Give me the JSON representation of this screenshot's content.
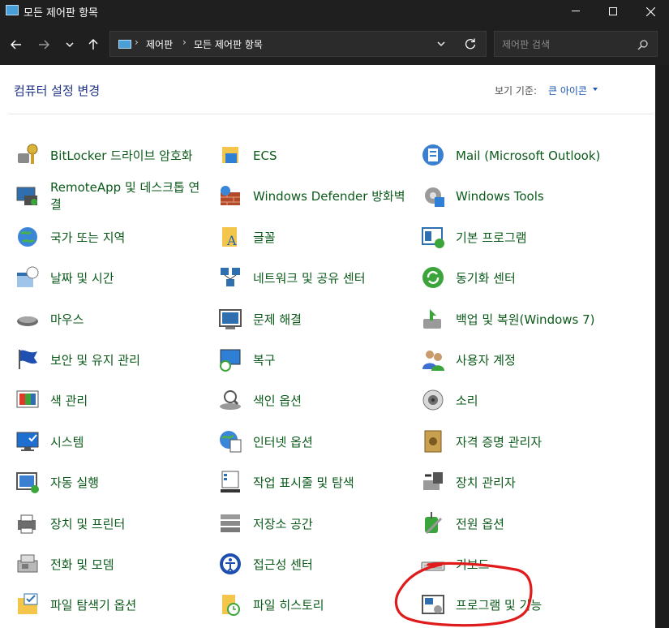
{
  "window": {
    "title": "모든 제어판 항목",
    "icon": "control-panel-icon"
  },
  "address": {
    "breadcrumbs": [
      "제어판",
      "모든 제어판 항목"
    ],
    "search_placeholder": "제어판 검색"
  },
  "main": {
    "heading": "컴퓨터 설정 변경",
    "view_by_label": "보기 기준:",
    "view_by_value": "큰 아이콘"
  },
  "items": [
    {
      "label": "BitLocker 드라이브 암호화",
      "icon": "bitlocker-icon"
    },
    {
      "label": "ECS",
      "icon": "ecs-folder-icon"
    },
    {
      "label": "Mail (Microsoft Outlook)",
      "icon": "mail-icon"
    },
    {
      "label": "RemoteApp 및 데스크톱 연결",
      "icon": "remoteapp-icon"
    },
    {
      "label": "Windows Defender 방화벽",
      "icon": "firewall-icon"
    },
    {
      "label": "Windows Tools",
      "icon": "windows-tools-icon"
    },
    {
      "label": "국가 또는 지역",
      "icon": "region-globe-icon"
    },
    {
      "label": "글꼴",
      "icon": "fonts-folder-icon"
    },
    {
      "label": "기본 프로그램",
      "icon": "default-programs-icon"
    },
    {
      "label": "날짜 및 시간",
      "icon": "date-time-icon"
    },
    {
      "label": "네트워크 및 공유 센터",
      "icon": "network-icon"
    },
    {
      "label": "동기화 센터",
      "icon": "sync-center-icon"
    },
    {
      "label": "마우스",
      "icon": "mouse-icon"
    },
    {
      "label": "문제 해결",
      "icon": "troubleshooting-icon"
    },
    {
      "label": "백업 및 복원(Windows 7)",
      "icon": "backup-restore-icon"
    },
    {
      "label": "보안 및 유지 관리",
      "icon": "security-flag-icon"
    },
    {
      "label": "복구",
      "icon": "recovery-icon"
    },
    {
      "label": "사용자 계정",
      "icon": "user-accounts-icon"
    },
    {
      "label": "색 관리",
      "icon": "color-management-icon"
    },
    {
      "label": "색인 옵션",
      "icon": "indexing-options-icon"
    },
    {
      "label": "소리",
      "icon": "sound-speaker-icon"
    },
    {
      "label": "시스템",
      "icon": "system-monitor-icon"
    },
    {
      "label": "인터넷 옵션",
      "icon": "internet-options-icon"
    },
    {
      "label": "자격 증명 관리자",
      "icon": "credential-vault-icon"
    },
    {
      "label": "자동 실행",
      "icon": "autoplay-icon"
    },
    {
      "label": "작업 표시줄 및 탐색",
      "icon": "taskbar-icon"
    },
    {
      "label": "장치 관리자",
      "icon": "device-manager-icon"
    },
    {
      "label": "장치 및 프린터",
      "icon": "devices-printers-icon"
    },
    {
      "label": "저장소 공간",
      "icon": "storage-spaces-icon"
    },
    {
      "label": "전원 옵션",
      "icon": "power-options-icon"
    },
    {
      "label": "전화 및 모뎀",
      "icon": "phone-modem-icon"
    },
    {
      "label": "접근성 센터",
      "icon": "ease-of-access-icon"
    },
    {
      "label": "키보드",
      "icon": "keyboard-icon"
    },
    {
      "label": "파일 탐색기 옵션",
      "icon": "file-explorer-options-icon"
    },
    {
      "label": "파일 히스토리",
      "icon": "file-history-icon"
    },
    {
      "label": "프로그램 및 기능",
      "icon": "programs-features-icon"
    }
  ],
  "colors": {
    "item_link": "#0b5a1a",
    "heading": "#1e3287",
    "annotation": "#e01b1b",
    "chrome_bg": "#1f1f1f"
  }
}
